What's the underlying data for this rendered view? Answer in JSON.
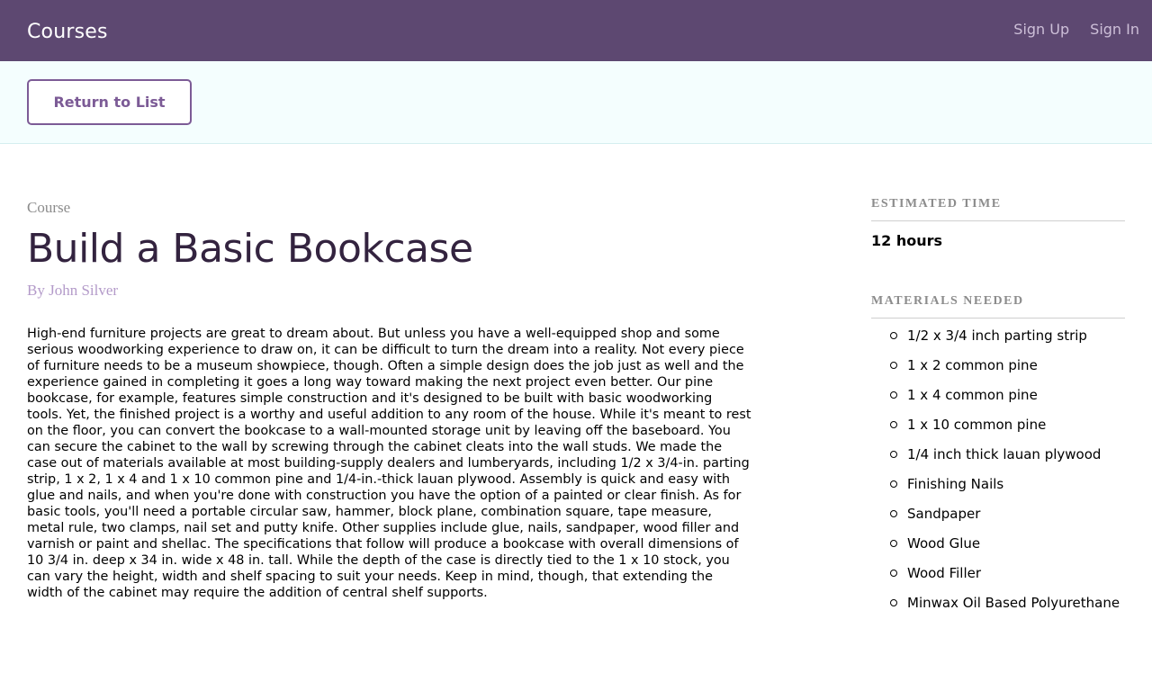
{
  "header": {
    "brand": "Courses",
    "nav": {
      "sign_up": "Sign Up",
      "sign_in": "Sign In"
    }
  },
  "actions": {
    "return_label": "Return to List"
  },
  "course": {
    "label": "Course",
    "title": "Build a Basic Bookcase",
    "author": "By John Silver",
    "description": "High-end furniture projects are great to dream about. But unless you have a well-equipped shop and some serious woodworking experience to draw on, it can be difficult to turn the dream into a reality. Not every piece of furniture needs to be a museum showpiece, though. Often a simple design does the job just as well and the experience gained in completing it goes a long way toward making the next project even better. Our pine bookcase, for example, features simple construction and it's designed to be built with basic woodworking tools. Yet, the finished project is a worthy and useful addition to any room of the house. While it's meant to rest on the floor, you can convert the bookcase to a wall-mounted storage unit by leaving off the baseboard. You can secure the cabinet to the wall by screwing through the cabinet cleats into the wall studs. We made the case out of materials available at most building-supply dealers and lumberyards, including 1/2 x 3/4-in. parting strip, 1 x 2, 1 x 4 and 1 x 10 common pine and 1/4-in.-thick lauan plywood. Assembly is quick and easy with glue and nails, and when you're done with construction you have the option of a painted or clear finish. As for basic tools, you'll need a portable circular saw, hammer, block plane, combination square, tape measure, metal rule, two clamps, nail set and putty knife. Other supplies include glue, nails, sandpaper, wood filler and varnish or paint and shellac. The specifications that follow will produce a bookcase with overall dimensions of 10 3/4 in. deep x 34 in. wide x 48 in. tall. While the depth of the case is directly tied to the 1 x 10 stock, you can vary the height, width and shelf spacing to suit your needs. Keep in mind, though, that extending the width of the cabinet may require the addition of central shelf supports."
  },
  "sidebar": {
    "estimated_time_heading": "Estimated Time",
    "estimated_time": "12 hours",
    "materials_heading": "Materials Needed",
    "materials": [
      "1/2 x 3/4 inch parting strip",
      "1 x 2 common pine",
      "1 x 4 common pine",
      "1 x 10 common pine",
      "1/4 inch thick lauan plywood",
      "Finishing Nails",
      "Sandpaper",
      "Wood Glue",
      "Wood Filler",
      "Minwax Oil Based Polyurethane"
    ]
  },
  "colors": {
    "header_bg": "#5d4871",
    "accent": "#7c5b96",
    "actions_bg": "#f4fefe"
  }
}
